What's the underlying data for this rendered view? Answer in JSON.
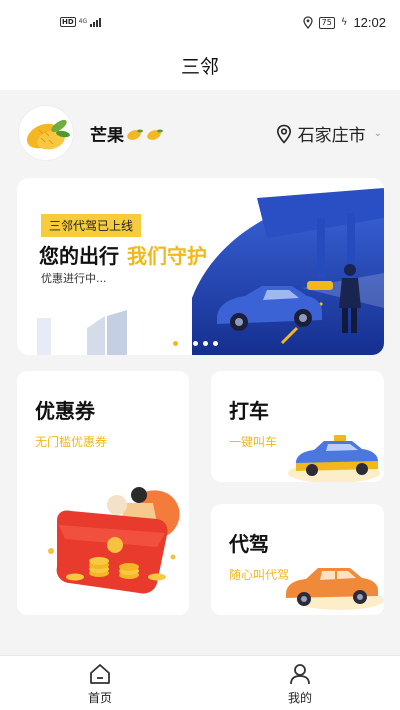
{
  "status_bar": {
    "hd": "HD",
    "network": "4G",
    "battery": "75",
    "time": "12:02"
  },
  "title": "三邻",
  "user": {
    "name": "芒果"
  },
  "location": {
    "city": "石家庄市"
  },
  "banner": {
    "tag": "三邻代驾已上线",
    "slogan_dark": "您的出行",
    "slogan_accent": "我们守护",
    "promo": "优惠进行中...",
    "dot_count": 5,
    "active_dot_index": 0
  },
  "cards": {
    "coupon": {
      "title": "优惠券",
      "subtitle": "无门槛优惠券"
    },
    "taxi": {
      "title": "打车",
      "subtitle": "一键叫车"
    },
    "driver": {
      "title": "代驾",
      "subtitle": "随心叫代驾"
    }
  },
  "bottom_nav": {
    "home_label": "首页",
    "mine_label": "我的"
  },
  "colors": {
    "accent": "#f2b81b",
    "tag_bg": "#f7cc3c",
    "banner_blue": "#1e3fb0",
    "car_orange": "#f08a3a"
  }
}
